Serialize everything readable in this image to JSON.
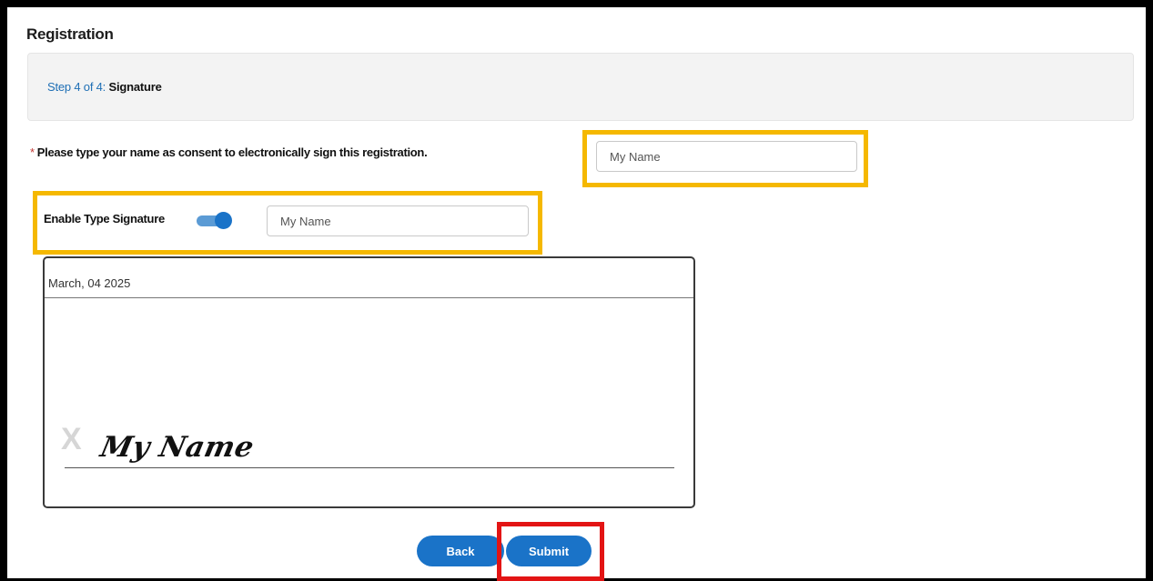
{
  "page": {
    "title": "Registration"
  },
  "step": {
    "prefix": "Step 4 of 4:",
    "name": "Signature"
  },
  "consent": {
    "required_marker": "*",
    "label": "Please type your name as consent to electronically sign this registration.",
    "placeholder": "My Name"
  },
  "type_signature": {
    "label": "Enable Type Signature",
    "enabled": true,
    "placeholder": "My Name"
  },
  "signature_pad": {
    "date": "March, 04 2025",
    "x_mark": "X",
    "signed_name": "My Name"
  },
  "buttons": {
    "back": "Back",
    "submit": "Submit"
  },
  "colors": {
    "accent": "#1a73c8",
    "highlight_yellow": "#f5b800",
    "highlight_red": "#e31414",
    "required": "#c23934"
  }
}
